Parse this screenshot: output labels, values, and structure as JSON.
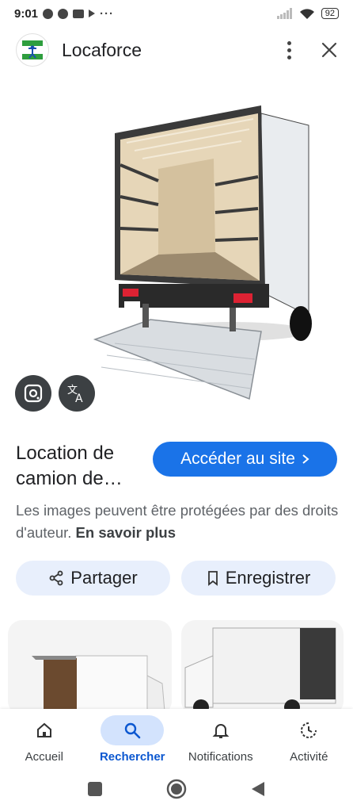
{
  "status_bar": {
    "time": "9:01",
    "battery": "92"
  },
  "header": {
    "title": "Locaforce",
    "logo_text": "LOCA FORCE"
  },
  "result": {
    "title": "Location de camion de…",
    "visit_label": "Accéder au site",
    "copyright_text": "Les images peuvent être protégées par des droits d'auteur.",
    "learn_more": "En savoir plus"
  },
  "actions": {
    "share_label": "Partager",
    "save_label": "Enregistrer"
  },
  "bottom_nav": {
    "items": [
      {
        "label": "Accueil",
        "icon": "home-icon"
      },
      {
        "label": "Rechercher",
        "icon": "search-icon"
      },
      {
        "label": "Notifications",
        "icon": "bell-icon"
      },
      {
        "label": "Activité",
        "icon": "activity-icon"
      }
    ]
  },
  "colors": {
    "accent": "#1a73e8",
    "pill": "#e8effc",
    "active_nav": "#d3e3fd"
  }
}
